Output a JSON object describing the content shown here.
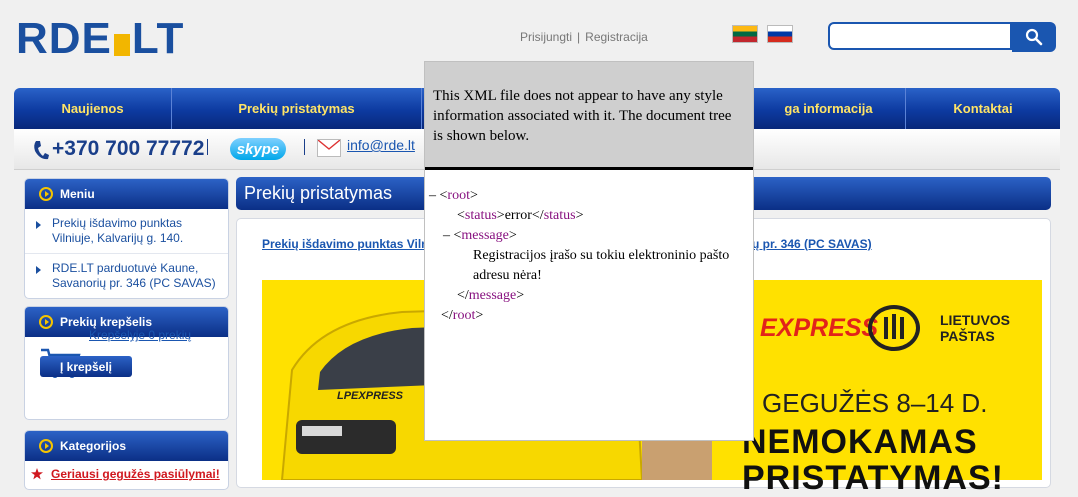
{
  "header": {
    "logo_left": "RDE",
    "logo_right": "LT",
    "login": "Prisijungti",
    "separator": "|",
    "register": "Registracija",
    "search_value": ""
  },
  "nav": [
    {
      "label": "Naujienos",
      "width": 158
    },
    {
      "label": "Prekių pristatymas",
      "width": 250
    },
    {
      "label": "",
      "width": 330
    },
    {
      "label": "ga informacija",
      "width": 154
    },
    {
      "label": "Kontaktai",
      "width": 154
    }
  ],
  "contact": {
    "phone": "+370 700 77772",
    "skype": "skype",
    "email": "info@rde.lt"
  },
  "sidebar": {
    "menu_title": "Meniu",
    "menu_items": [
      "Prekių išdavimo punktas Vilniuje, Kalvarijų g. 140.",
      "RDE.LT parduotuvė Kaune, Savanorių pr. 346 (PC SAVAS)"
    ],
    "cart_title": "Prekių krepšelis",
    "cart_link": "Krepšelyje 0 prekių",
    "cart_button": "Į krepšelį",
    "categories_title": "Kategorijos",
    "promo": "Geriausi gegužės pasiūlymai!"
  },
  "main": {
    "title": "Prekių pristatymas",
    "link_left": "Prekių išdavimo punktas Viln",
    "link_right": "rių pr. 346 (PC SAVAS)",
    "banner": {
      "express": "EXPRESS",
      "post_line1": "LIETUVOS",
      "post_line2": "PAŠTAS",
      "van_text": "LPEXPRESS",
      "date": "GEGUŽĖS 8–14 D.",
      "free_line1": "NEMOKAMAS",
      "free_line2": "PRISTATYMAS!"
    }
  },
  "xml": {
    "note": "This XML file does not appear to have any style information associated with it. The document tree is shown below.",
    "collapse": "–",
    "root_tag": "root",
    "status_tag": "status",
    "status_value": "error",
    "message_tag": "message",
    "message_value": "Registracijos įrašo su tokiu elektroninio pašto adresu nėra!"
  },
  "colors": {
    "brand_blue": "#1a4f9f",
    "nav_text": "#ffe466",
    "banner_yellow": "#ffe100",
    "xml_tag": "#881280"
  }
}
